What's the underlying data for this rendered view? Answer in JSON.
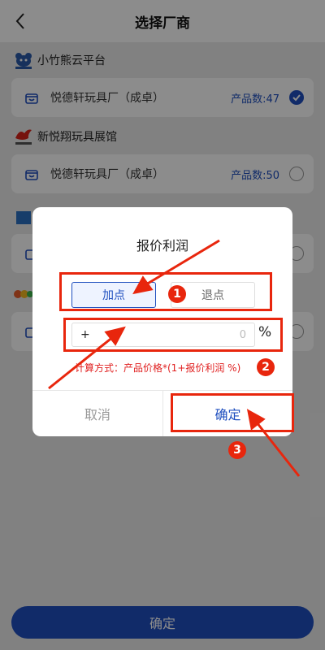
{
  "header": {
    "title": "选择厂商"
  },
  "sections": [
    {
      "platform": "小竹熊云平台",
      "vendor": "悦德轩玩具厂（成卓）",
      "count": "产品数:47",
      "checked": true
    },
    {
      "platform": "新悦翔玩具展馆",
      "vendor": "悦德轩玩具厂（成卓）",
      "count": "产品数:50",
      "checked": false
    }
  ],
  "modal": {
    "title": "报价利润",
    "add_label": "加点",
    "sub_label": "退点",
    "sign": "+",
    "input_placeholder": "0",
    "percent": "%",
    "formula": "计算方式：产品价格*(1+报价利润 %)",
    "cancel_label": "取消",
    "confirm_label": "确定"
  },
  "bottom": {
    "confirm_label": "确定"
  },
  "annotations": {
    "n1": "1",
    "n2": "2",
    "n3": "3"
  },
  "colors": {
    "brand": "#1f4fbf",
    "annotation": "#e8260d"
  }
}
